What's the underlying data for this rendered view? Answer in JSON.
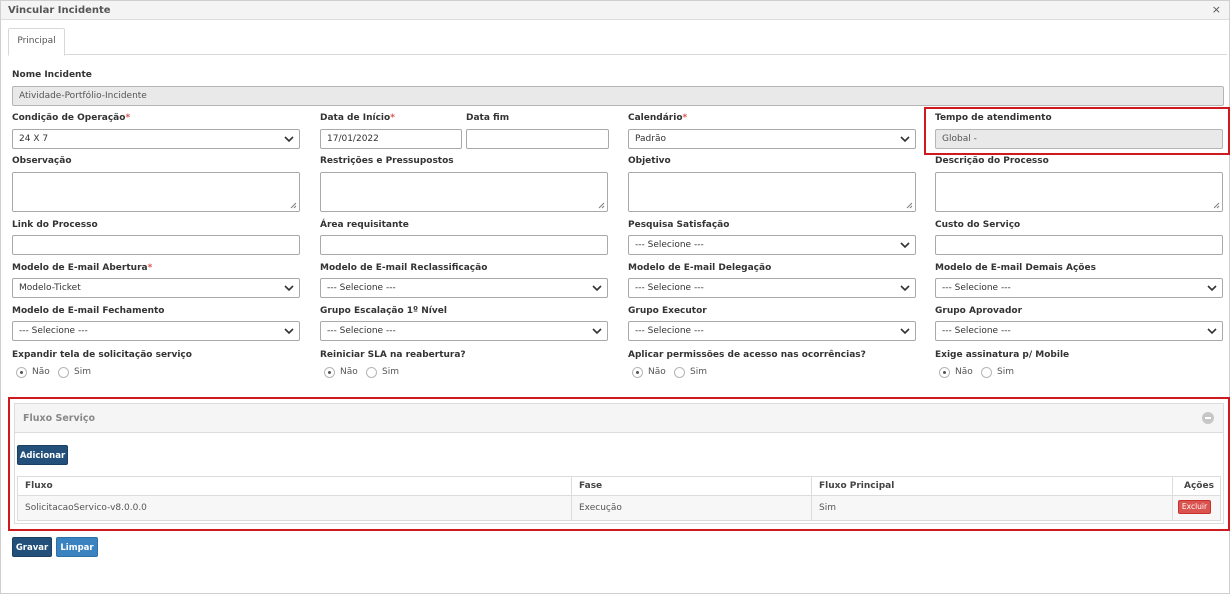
{
  "window": {
    "title": "Vincular Incidente",
    "close_symbol": "×"
  },
  "tabs": [
    {
      "label": "Principal"
    }
  ],
  "form": {
    "nome_incidente": {
      "label": "Nome Incidente",
      "value": "Atividade-Portfólio-Incidente"
    },
    "condicao_operacao": {
      "label": "Condição de Operação",
      "required": "*",
      "value": "24 X 7"
    },
    "data_inicio": {
      "label": "Data de Início",
      "required": "*",
      "value": "17/01/2022"
    },
    "data_fim": {
      "label": "Data fim",
      "value": ""
    },
    "calendario": {
      "label": "Calendário",
      "required": "*",
      "value": "Padrão"
    },
    "tempo_atendimento": {
      "label": "Tempo de atendimento",
      "value": "Global -"
    },
    "observacao": {
      "label": "Observação"
    },
    "restricoes": {
      "label": "Restrições e Pressupostos"
    },
    "objetivo": {
      "label": "Objetivo"
    },
    "descricao_processo": {
      "label": "Descrição do Processo"
    },
    "link_processo": {
      "label": "Link do Processo",
      "value": ""
    },
    "area_requisitante": {
      "label": "Área requisitante",
      "value": ""
    },
    "pesquisa_satisfacao": {
      "label": "Pesquisa Satisfação",
      "value": "--- Selecione ---"
    },
    "custo_servico": {
      "label": "Custo do Serviço",
      "value": ""
    },
    "email_abertura": {
      "label": "Modelo de E-mail Abertura",
      "required": "*",
      "value": "Modelo-Ticket"
    },
    "email_reclassificacao": {
      "label": "Modelo de E-mail Reclassificação",
      "value": "--- Selecione ---"
    },
    "email_delegacao": {
      "label": "Modelo de E-mail Delegação",
      "value": "--- Selecione ---"
    },
    "email_demais_acoes": {
      "label": "Modelo de E-mail Demais Ações",
      "value": "--- Selecione ---"
    },
    "email_fechamento": {
      "label": "Modelo de E-mail Fechamento",
      "value": "--- Selecione ---"
    },
    "grupo_escalacao": {
      "label": "Grupo Escalação 1º Nível",
      "value": "--- Selecione ---"
    },
    "grupo_executor": {
      "label": "Grupo Executor",
      "value": "--- Selecione ---"
    },
    "grupo_aprovador": {
      "label": "Grupo Aprovador",
      "value": "--- Selecione ---"
    },
    "expandir_tela": {
      "label": "Expandir tela de solicitação serviço",
      "options": [
        "Não",
        "Sim"
      ],
      "selected": "Não"
    },
    "reiniciar_sla": {
      "label": "Reiniciar SLA na reabertura?",
      "options": [
        "Não",
        "Sim"
      ],
      "selected": "Não"
    },
    "aplicar_permissoes": {
      "label": "Aplicar permissões de acesso nas ocorrências?",
      "options": [
        "Não",
        "Sim"
      ],
      "selected": "Não"
    },
    "exige_assinatura": {
      "label": "Exige assinatura p/ Mobile",
      "options": [
        "Não",
        "Sim"
      ],
      "selected": "Não"
    }
  },
  "fluxo_servico": {
    "title": "Fluxo Serviço",
    "add_button": "Adicionar",
    "columns": [
      "Fluxo",
      "Fase",
      "Fluxo Principal",
      "Ações"
    ],
    "rows": [
      {
        "fluxo": "SolicitacaoServico-v8.0.0.0",
        "fase": "Execução",
        "principal": "Sim",
        "action": "Excluir"
      }
    ]
  },
  "footer": {
    "save_button": "Gravar",
    "clear_button": "Limpar"
  },
  "colors": {
    "primary_button": "#22507a",
    "secondary_button": "#3a83c0",
    "danger": "#d9534f",
    "highlight": "#d0191f"
  },
  "icons": {
    "dropdown": "chevron-down-icon",
    "collapse": "minus-circle-icon",
    "close": "close-icon",
    "resize": "resize-grip-icon"
  }
}
